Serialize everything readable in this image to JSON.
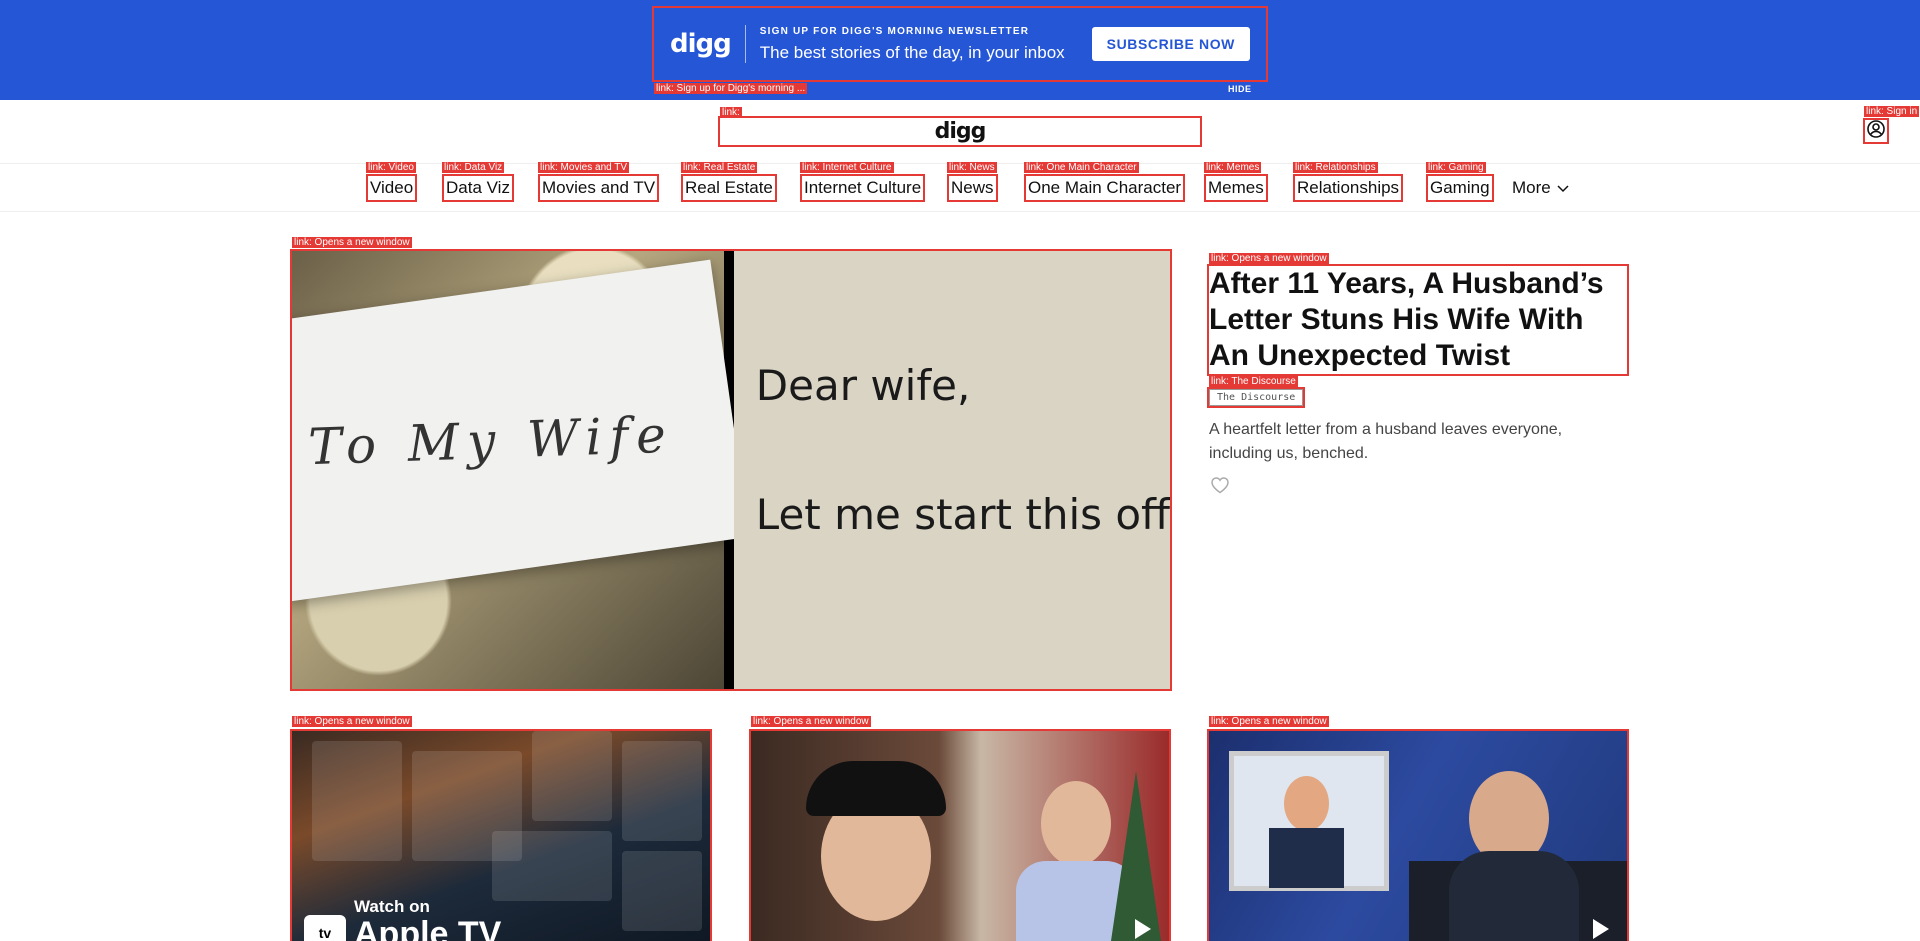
{
  "banner": {
    "logo": "digg",
    "kicker": "SIGN UP FOR DIGG'S MORNING NEWSLETTER",
    "headline": "The best stories of the day, in your inbox",
    "subscribe_label": "SUBSCRIBE NOW",
    "hide_label": "HIDE",
    "annotation": "link: Sign up for Digg's morning ..."
  },
  "header": {
    "logo": "digg",
    "logo_annotation": "link:",
    "signin_annotation": "link: Sign in"
  },
  "nav": {
    "items": [
      {
        "label": "Video",
        "annotation": "link: Video"
      },
      {
        "label": "Data Viz",
        "annotation": "link: Data Viz"
      },
      {
        "label": "Movies and TV",
        "annotation": "link: Movies and TV"
      },
      {
        "label": "Real Estate",
        "annotation": "link: Real Estate"
      },
      {
        "label": "Internet Culture",
        "annotation": "link: Internet Culture"
      },
      {
        "label": "News",
        "annotation": "link: News"
      },
      {
        "label": "One Main Character",
        "annotation": "link: One Main Character"
      },
      {
        "label": "Memes",
        "annotation": "link: Memes"
      },
      {
        "label": "Relationships",
        "annotation": "link: Relationships"
      },
      {
        "label": "Gaming",
        "annotation": "link: Gaming"
      }
    ],
    "more_label": "More"
  },
  "hero": {
    "image_annotation": "link: Opens a new window",
    "envelope_text": "To My Wife",
    "letter_line1": "Dear wife,",
    "letter_line2": "Let me start this off",
    "title_annotation": "link: Opens a new window",
    "title": "After 11 Years, A Husband’s Letter Stuns His Wife With An Unexpected Twist",
    "source_annotation": "link: The Discourse",
    "source": "The Discourse",
    "description": "A heartfelt letter from a husband leaves everyone, including us, benched."
  },
  "cards": [
    {
      "annotation": "link: Opens a new window",
      "watch_on": "Watch on",
      "brand": "Apple TV",
      "badge": "tv"
    },
    {
      "annotation": "link: Opens a new window"
    },
    {
      "annotation": "link: Opens a new window"
    }
  ],
  "colors": {
    "banner_bg": "#2456d6",
    "annotation": "#e53935"
  }
}
